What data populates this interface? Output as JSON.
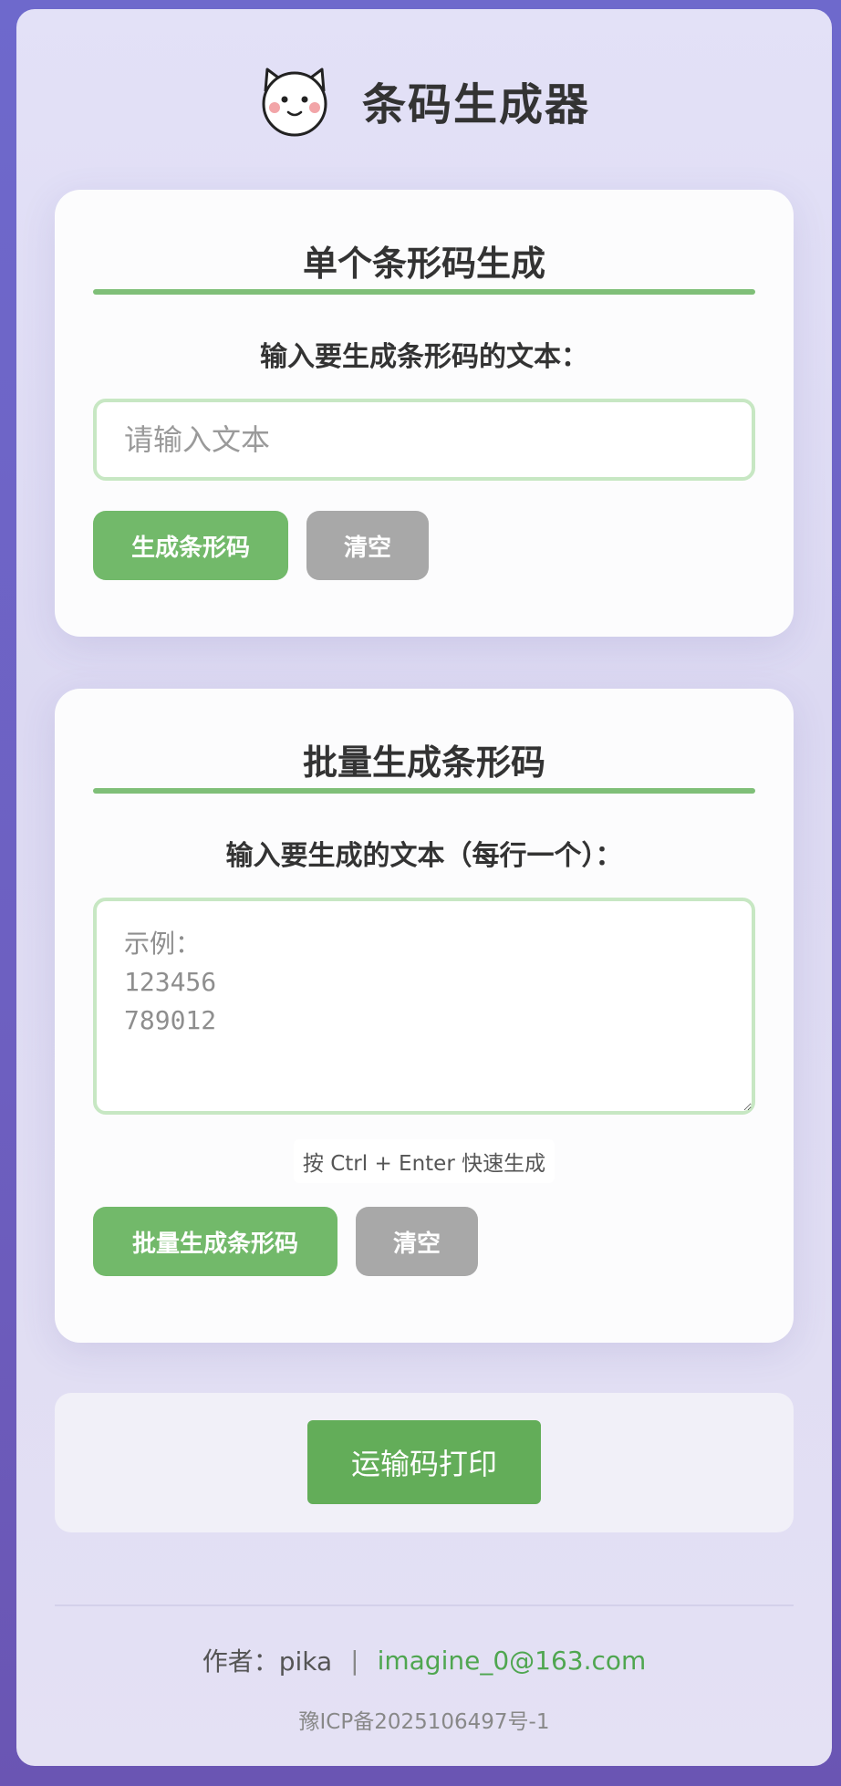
{
  "header": {
    "title": "条码生成器",
    "logo_icon": "cat-face-icon"
  },
  "single": {
    "title": "单个条形码生成",
    "label": "输入要生成条形码的文本：",
    "placeholder": "请输入文本",
    "value": "",
    "generate_label": "生成条形码",
    "clear_label": "清空"
  },
  "batch": {
    "title": "批量生成条形码",
    "label": "输入要生成的文本（每行一个）：",
    "placeholder": "示例：\n123456\n789012",
    "value": "",
    "hint": "按 Ctrl + Enter 快速生成",
    "generate_label": "批量生成条形码",
    "clear_label": "清空"
  },
  "print": {
    "label": "运输码打印"
  },
  "footer": {
    "author": "作者：pika",
    "separator": "|",
    "email": "imagine_0@163.com",
    "icp": "豫ICP备2025106497号-1"
  },
  "colors": {
    "accent_green": "#72b96a",
    "print_green": "#63ad59",
    "divider_green": "#7fbf78",
    "clear_gray": "#a8a8a8",
    "background_purple": "#6e69cc"
  }
}
